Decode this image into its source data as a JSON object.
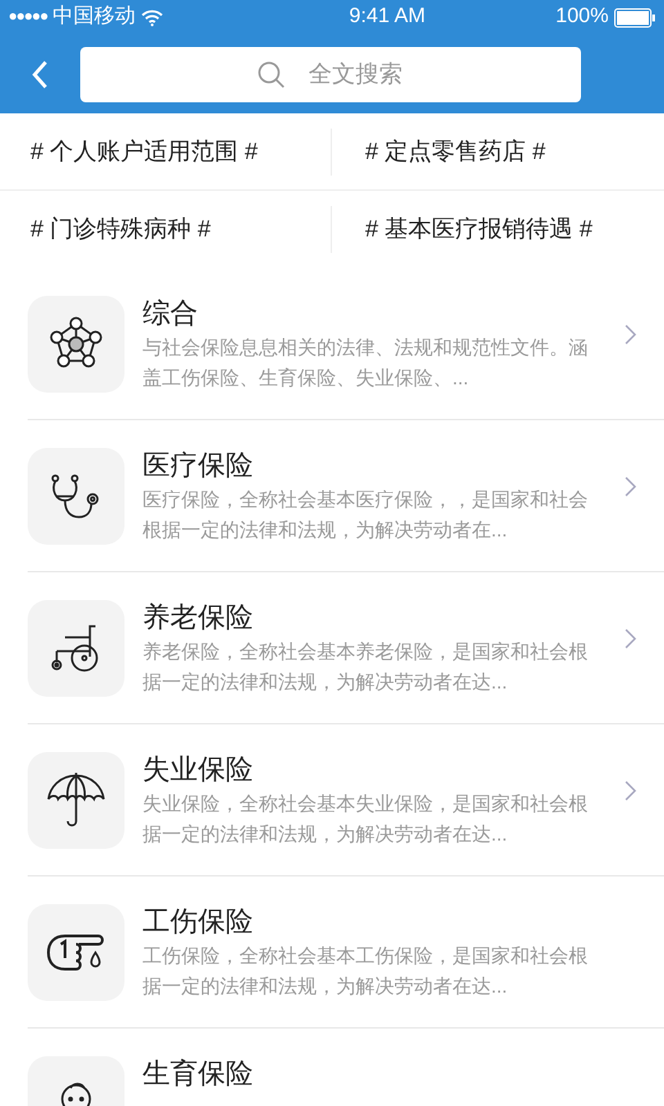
{
  "status_bar": {
    "signal": "●●●●●",
    "carrier": "中国移动",
    "time": "9:41 AM",
    "battery": "100%"
  },
  "search": {
    "placeholder": "全文搜索"
  },
  "tags": [
    "# 个人账户适用范围 #",
    "# 定点零售药店 #",
    "# 门诊特殊病种 #",
    "# 基本医疗报销待遇 #"
  ],
  "items": [
    {
      "title": "综合",
      "description": "与社会保险息息相关的法律、法规和规范性文件。涵盖工伤保险、生育保险、失业保险、...",
      "chevron": true
    },
    {
      "title": "医疗保险",
      "description": "医疗保险，全称社会基本医疗保险，，是国家和社会根据一定的法律和法规，为解决劳动者在...",
      "chevron": true
    },
    {
      "title": "养老保险",
      "description": "养老保险，全称社会基本养老保险，是国家和社会根据一定的法律和法规，为解决劳动者在达...",
      "chevron": true
    },
    {
      "title": "失业保险",
      "description": "失业保险，全称社会基本失业保险，是国家和社会根据一定的法律和法规，为解决劳动者在达...",
      "chevron": true
    },
    {
      "title": "工伤保险",
      "description": "工伤保险，全称社会基本工伤保险，是国家和社会根据一定的法律和法规，为解决劳动者在达...",
      "chevron": false
    },
    {
      "title": "生育保险",
      "chevron": false
    }
  ]
}
